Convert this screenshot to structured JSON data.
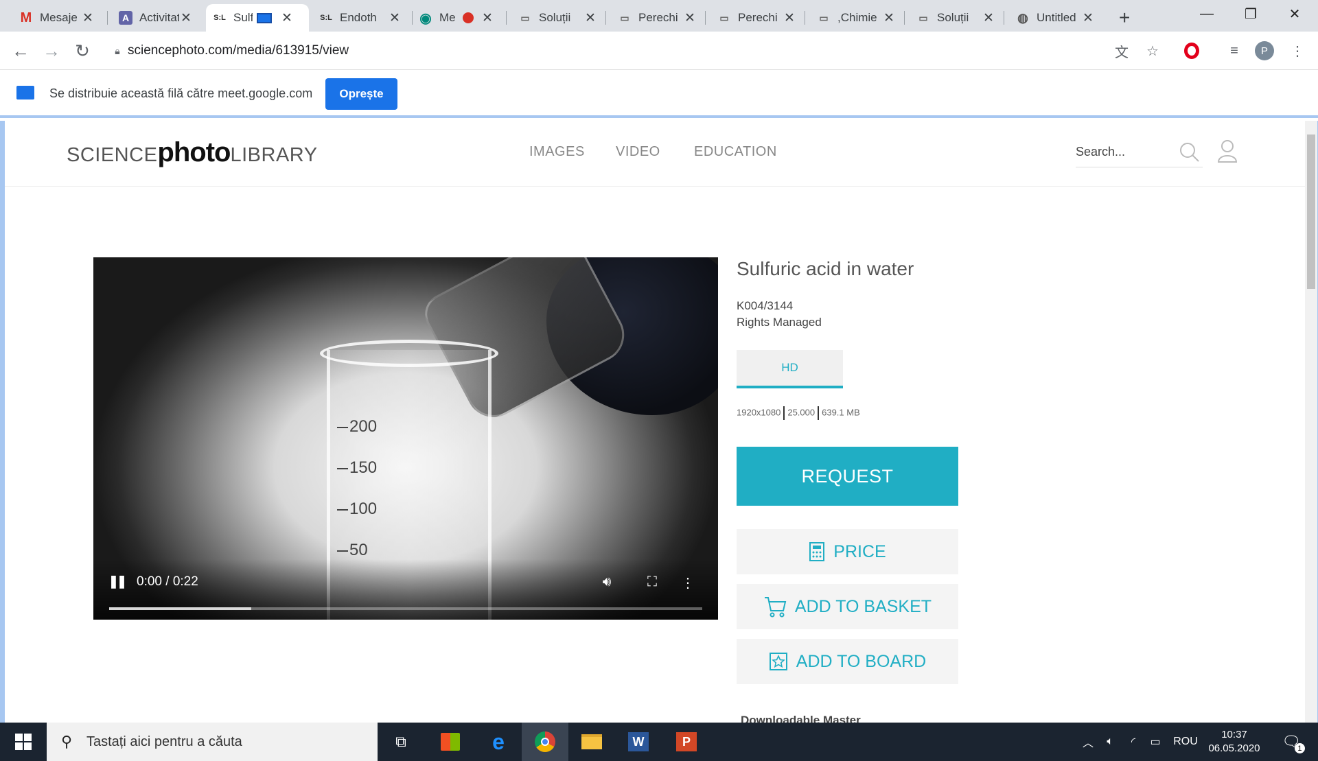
{
  "browser": {
    "tabs": [
      {
        "title": "Mesaje",
        "icon": "gmail-icon"
      },
      {
        "title": "Activitate",
        "icon": "teams-icon"
      },
      {
        "title": "Sulfuric",
        "icon": "spl-icon"
      },
      {
        "title": "Endoth",
        "icon": "spl-icon"
      },
      {
        "title": "Meet",
        "icon": "meet-icon"
      },
      {
        "title": "Soluții",
        "icon": "slides-icon"
      },
      {
        "title": "Perechi",
        "icon": "slides-icon"
      },
      {
        "title": "Perechi",
        "icon": "slides-icon"
      },
      {
        "title": ",Chimie",
        "icon": "slides-icon"
      },
      {
        "title": "Soluții",
        "icon": "slides-icon"
      },
      {
        "title": "Untitled",
        "icon": "globe-icon"
      }
    ],
    "active_tab": 2,
    "url": "sciencephoto.com/media/613915/view",
    "profile_initial": "P"
  },
  "sharebar": {
    "text": "Se distribuie această filă către meet.google.com",
    "stop_label": "Oprește"
  },
  "site": {
    "logo": {
      "part1": "SCIENCE",
      "part2": "photo",
      "part3": "LIBRARY"
    },
    "nav": [
      "IMAGES",
      "VIDEO",
      "EDUCATION"
    ],
    "search_placeholder": "Search..."
  },
  "video": {
    "time": "0:00 / 0:22",
    "progress_buffered": 0.24,
    "graduations": [
      "200",
      "150",
      "100",
      "50"
    ]
  },
  "media": {
    "title": "Sulfuric acid in water",
    "id": "K004/3144",
    "rights": "Rights Managed",
    "format_tab": "HD",
    "specs": [
      "1920x1080",
      "25.000",
      "639.1 MB"
    ],
    "request_label": "REQUEST",
    "price_label": "PRICE",
    "basket_label": "ADD TO BASKET",
    "board_label": "ADD TO BOARD",
    "download_label": "Downloadable Master"
  },
  "taskbar": {
    "search_placeholder": "Tastați aici pentru a căuta",
    "language": "ROU",
    "time": "10:37",
    "date": "06.05.2020",
    "notification_count": "1"
  },
  "colors": {
    "accent": "#20aec4",
    "chrome_blue": "#1a73e8",
    "taskbar": "#1b2430"
  }
}
